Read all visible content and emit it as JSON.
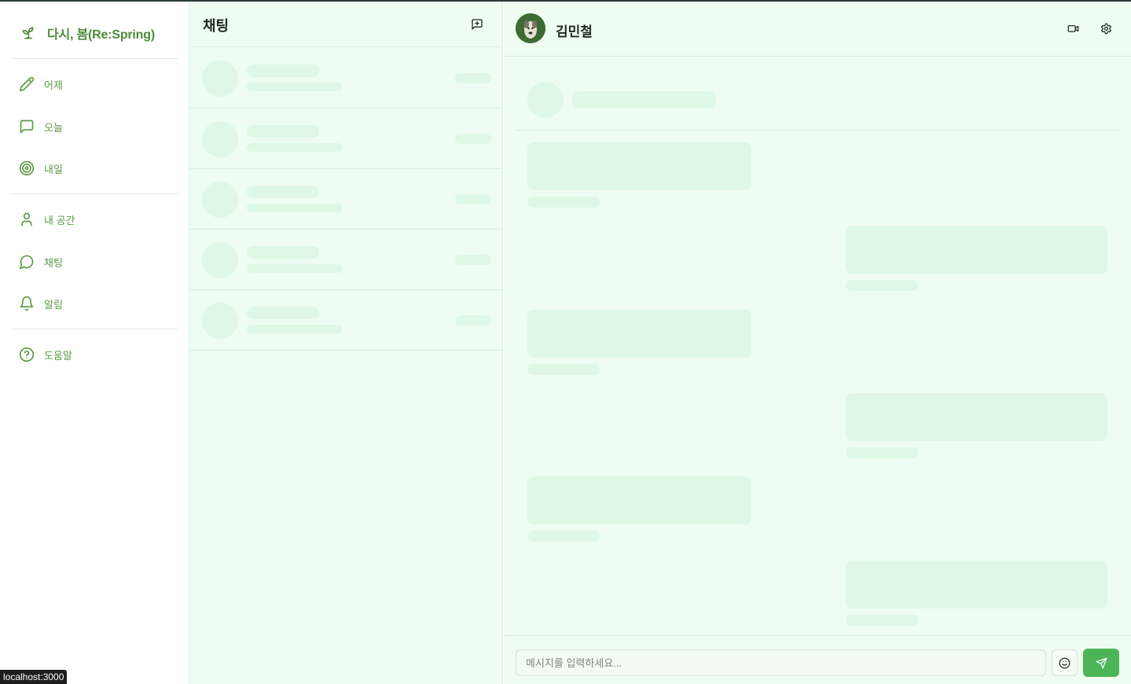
{
  "brand": {
    "title": "다시, 봄(Re:Spring)",
    "icon": "sprout-icon"
  },
  "sidebar": {
    "groups": [
      [
        {
          "label": "어제",
          "icon": "pencil-icon"
        },
        {
          "label": "오늘",
          "icon": "message-square-icon"
        },
        {
          "label": "내일",
          "icon": "target-icon"
        }
      ],
      [
        {
          "label": "내 공간",
          "icon": "user-icon"
        },
        {
          "label": "채팅",
          "icon": "message-circle-icon"
        },
        {
          "label": "알림",
          "icon": "bell-icon"
        }
      ],
      [
        {
          "label": "도움말",
          "icon": "help-circle-icon"
        }
      ]
    ]
  },
  "chat_list": {
    "title": "채팅",
    "new_chat_icon": "message-plus-icon",
    "skeleton_rows": 5
  },
  "conversation": {
    "peer_name": "김민철",
    "video_icon": "video-icon",
    "settings_icon": "gear-icon",
    "skeleton_messages": [
      "left",
      "right",
      "left",
      "right",
      "left",
      "right"
    ]
  },
  "composer": {
    "placeholder": "메시지를 입력하세요...",
    "emoji_icon": "smile-icon",
    "send_icon": "send-icon"
  },
  "status_bar": {
    "url": "localhost:3000"
  },
  "colors": {
    "accent": "#4cb556",
    "brand_text": "#4f8a3a",
    "nav_text": "#5c9a45",
    "panel_bg": "#effcf1",
    "skeleton": "#dff8e5"
  }
}
